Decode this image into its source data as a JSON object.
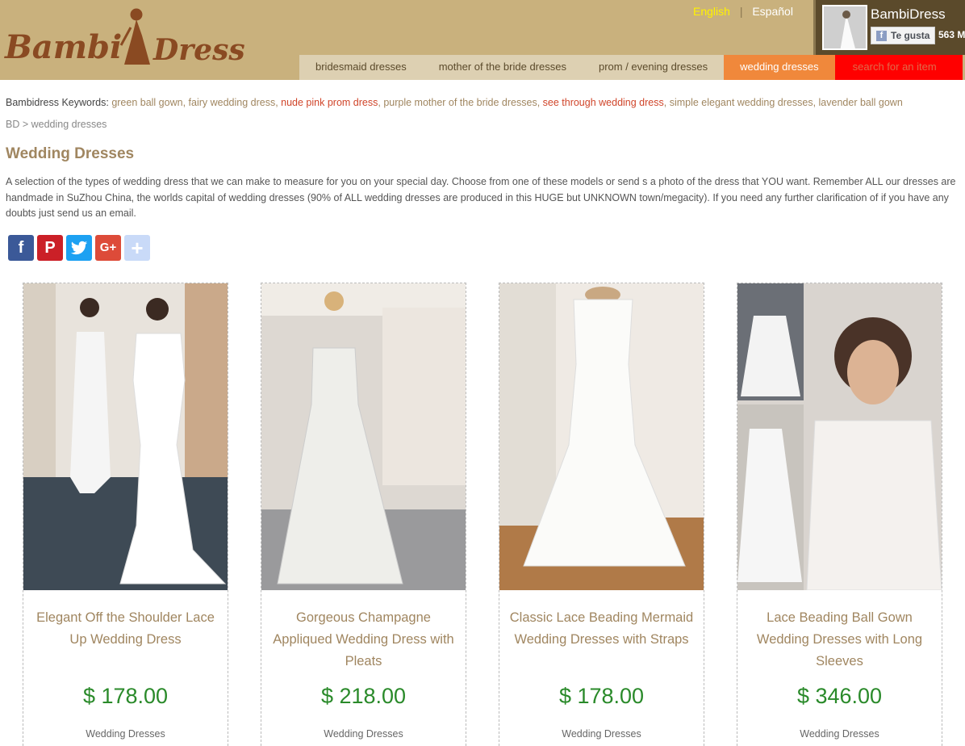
{
  "logo": {
    "text": "BambiDress",
    "alt": "Bambi Dress logo"
  },
  "languages": {
    "english": "English",
    "spanish": "Español"
  },
  "facebook": {
    "page_name": "BambiDress",
    "like_label": "Te gusta",
    "like_count": "563 M"
  },
  "nav": {
    "items": [
      {
        "label": "bridesmaid dresses"
      },
      {
        "label": "mother of the bride dresses"
      },
      {
        "label": "prom / evening dresses"
      },
      {
        "label": "wedding dresses"
      }
    ],
    "search_label": "search for an item"
  },
  "keywords": {
    "prefix": "Bambidress Keywords: ",
    "items": [
      "green ball gown, ",
      "fairy wedding dress, ",
      "nude pink prom dress",
      ", ",
      "purple mother of the bride dresses, ",
      "see through wedding dress",
      ", simple elegant wedding dresses, ",
      "lavender ball gown"
    ]
  },
  "breadcrumb": {
    "home": "BD",
    "sep": " > ",
    "current": "wedding dresses"
  },
  "page": {
    "title": "Wedding Dresses",
    "description": "A selection of the types of wedding dress that we can make to measure for you on your special day. Choose from one of these models or send s a photo of the dress that YOU want. Remember ALL our dresses are handmade in SuZhou China, the worlds capital of wedding dresses (90% of ALL wedding dresses are produced in this HUGE but UNKNOWN town/megacity). If you need any further clarification of if you have any doubts just send us an email."
  },
  "share": {
    "facebook": "f",
    "pinterest": "P",
    "twitter": "t",
    "googleplus": "G+",
    "more": "+"
  },
  "products": [
    {
      "name": "Elegant Off the Shoulder Lace Up Wedding Dress",
      "price": "$ 178.00",
      "category": "Wedding Dresses"
    },
    {
      "name": "Gorgeous Champagne Appliqued Wedding Dress with Pleats",
      "price": "$ 218.00",
      "category": "Wedding Dresses"
    },
    {
      "name": "Classic Lace Beading Mermaid Wedding Dresses with Straps",
      "price": "$ 178.00",
      "category": "Wedding Dresses"
    },
    {
      "name": "Lace Beading Ball Gown Wedding Dresses with Long Sleeves",
      "price": "$ 346.00",
      "category": "Wedding Dresses"
    }
  ],
  "colors": {
    "header": "#c9b17d",
    "nav": "#ddd0b2",
    "nav_active": "#f0883b",
    "search": "#ff0000",
    "price": "#2a8a2a",
    "accent": "#a08660"
  }
}
